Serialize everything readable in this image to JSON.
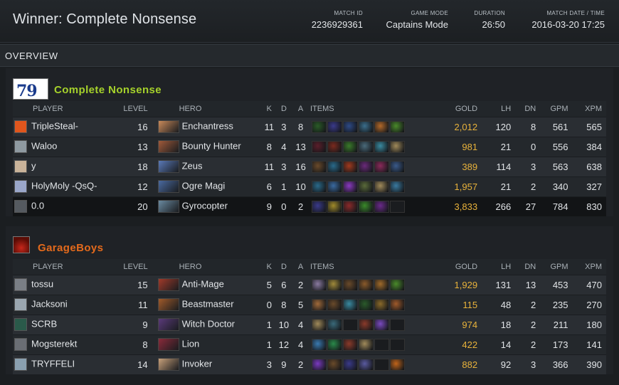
{
  "header": {
    "winner": "Winner: Complete Nonsense",
    "match_id_label": "MATCH ID",
    "match_id": "2236929361",
    "mode_label": "GAME MODE",
    "mode": "Captains Mode",
    "duration_label": "DURATION",
    "duration": "26:50",
    "date_label": "MATCH DATE / TIME",
    "date": "2016-03-20 17:25"
  },
  "section": "OVERVIEW",
  "columns": [
    "PLAYER",
    "LEVEL",
    "HERO",
    "K",
    "D",
    "A",
    "ITEMS",
    "GOLD",
    "LH",
    "DN",
    "GPM",
    "XPM"
  ],
  "colors": {
    "radiant": "#a6d22b",
    "dire": "#e46a1c",
    "gold": "#e8b23b"
  },
  "teams": [
    {
      "name": "Complete Nonsense",
      "logo_text": "79",
      "players": [
        {
          "player": "TripleSteal-",
          "level": "16",
          "hero": "Enchantress",
          "k": "11",
          "d": "3",
          "a": "8",
          "gold": "2,012",
          "lh": "120",
          "dn": "8",
          "gpm": "561",
          "xpm": "565",
          "avatar": "#e0561d",
          "hero_color": "#c98a5a",
          "items": [
            "#2a5b27",
            "#3a3a8a",
            "#2e4a86",
            "#3b6e8c",
            "#b2692a",
            "#4a8a2a"
          ]
        },
        {
          "player": "Waloo",
          "level": "13",
          "hero": "Bounty Hunter",
          "k": "8",
          "d": "4",
          "a": "13",
          "gold": "981",
          "lh": "21",
          "dn": "0",
          "gpm": "556",
          "xpm": "384",
          "avatar": "#8f9aa1",
          "hero_color": "#a05a3a",
          "items": [
            "#5a1e2a",
            "#7a2a1e",
            "#3a7a2a",
            "#4a6a7a",
            "#3a8aa0",
            "#a08a5a"
          ]
        },
        {
          "player": "y",
          "level": "18",
          "hero": "Zeus",
          "k": "11",
          "d": "3",
          "a": "16",
          "gold": "389",
          "lh": "114",
          "dn": "3",
          "gpm": "563",
          "xpm": "638",
          "avatar": "#c9b39a",
          "hero_color": "#5a7ab8",
          "items": [
            "#6a4a2a",
            "#2a6a8a",
            "#a03a1e",
            "#6a2a7a",
            "#8a2a5a",
            "#3a5a8a"
          ]
        },
        {
          "player": "HolyMoly -QsQ-",
          "level": "12",
          "hero": "Ogre Magi",
          "k": "6",
          "d": "1",
          "a": "10",
          "gold": "1,957",
          "lh": "21",
          "dn": "2",
          "gpm": "340",
          "xpm": "327",
          "avatar": "#9aa6c9",
          "hero_color": "#4a6aa0",
          "items": [
            "#2a6a8a",
            "#3a6aa0",
            "#8a3ac0",
            "#5a6a3a",
            "#a08a5a",
            "#3a7aa0"
          ]
        },
        {
          "player": "0.0",
          "level": "20",
          "hero": "Gyrocopter",
          "k": "9",
          "d": "0",
          "a": "2",
          "gold": "3,833",
          "lh": "266",
          "dn": "27",
          "gpm": "784",
          "xpm": "830",
          "avatar": "#555a60",
          "hero_color": "#6a8aa0",
          "items": [
            "#3a3a8a",
            "#a08a2a",
            "#8a2a2a",
            "#3a8a2a",
            "#6a2a8a",
            "#1a1c1f"
          ]
        }
      ]
    },
    {
      "name": "GarageBoys",
      "logo_text": "",
      "players": [
        {
          "player": "tossu",
          "level": "15",
          "hero": "Anti-Mage",
          "k": "5",
          "d": "6",
          "a": "2",
          "gold": "1,929",
          "lh": "131",
          "dn": "13",
          "gpm": "453",
          "xpm": "470",
          "avatar": "#7a7f86",
          "hero_color": "#a03a2a",
          "items": [
            "#8a7aa0",
            "#a08a3a",
            "#6a4a2a",
            "#8a5a2a",
            "#a06a2a",
            "#4a8a2a"
          ]
        },
        {
          "player": "Jacksoni",
          "level": "11",
          "hero": "Beastmaster",
          "k": "0",
          "d": "8",
          "a": "5",
          "gold": "115",
          "lh": "48",
          "dn": "2",
          "gpm": "235",
          "xpm": "270",
          "avatar": "#9aa6b0",
          "hero_color": "#a05a2a",
          "items": [
            "#a06a3a",
            "#6a4a2a",
            "#3a8aa0",
            "#2a5a2a",
            "#8a6a2a",
            "#a05a2a"
          ]
        },
        {
          "player": "SCRB",
          "level": "9",
          "hero": "Witch Doctor",
          "k": "1",
          "d": "10",
          "a": "4",
          "gold": "974",
          "lh": "18",
          "dn": "2",
          "gpm": "211",
          "xpm": "180",
          "avatar": "#2a5a4a",
          "hero_color": "#5a3a7a",
          "items": [
            "#a08a5a",
            "#3a6a7a",
            "#1a1c1f",
            "#8a3a2a",
            "#7a4ac0",
            "#1a1c1f"
          ]
        },
        {
          "player": "Mogsterekt",
          "level": "8",
          "hero": "Lion",
          "k": "1",
          "d": "12",
          "a": "4",
          "gold": "422",
          "lh": "14",
          "dn": "2",
          "gpm": "173",
          "xpm": "141",
          "avatar": "#6a6e74",
          "hero_color": "#8a2a3a",
          "items": [
            "#3a7ab0",
            "#2a8a4a",
            "#8a3a2a",
            "#a08a5a",
            "#1a1c1f",
            "#1a1c1f"
          ]
        },
        {
          "player": "TRYFFELI",
          "level": "14",
          "hero": "Invoker",
          "k": "3",
          "d": "9",
          "a": "2",
          "gold": "882",
          "lh": "92",
          "dn": "3",
          "gpm": "366",
          "xpm": "390",
          "avatar": "#8aa0b0",
          "hero_color": "#c8a07a",
          "items": [
            "#7a3ac0",
            "#6a4a2a",
            "#3a3a8a",
            "#5a5aa0",
            "#1a1c1f",
            "#c0641a"
          ]
        }
      ]
    }
  ]
}
